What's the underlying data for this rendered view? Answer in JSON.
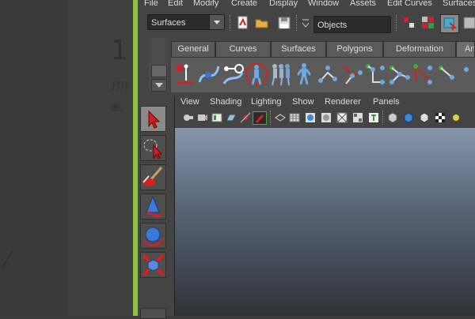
{
  "background_doc": {
    "heading_digit": "1",
    "line1": "打开",
    "line2": "面,"
  },
  "menubar": {
    "items": [
      "File",
      "Edit",
      "Modify",
      "Create",
      "Display",
      "Window",
      "Assets",
      "Edit Curves",
      "Surfaces"
    ]
  },
  "status": {
    "menu_set": "Surfaces",
    "selection_mode": "Objects"
  },
  "shelf": {
    "tabs": [
      "General",
      "Curves",
      "Surfaces",
      "Polygons",
      "Deformation",
      "An"
    ],
    "active_tab": "An"
  },
  "panel": {
    "menus": [
      "View",
      "Shading",
      "Lighting",
      "Show",
      "Renderer",
      "Panels"
    ]
  },
  "colors": {
    "accent_green": "#8cc43a",
    "selection_red": "#d42020",
    "viewport_top": "#8696ac",
    "viewport_bottom": "#2f3338"
  }
}
